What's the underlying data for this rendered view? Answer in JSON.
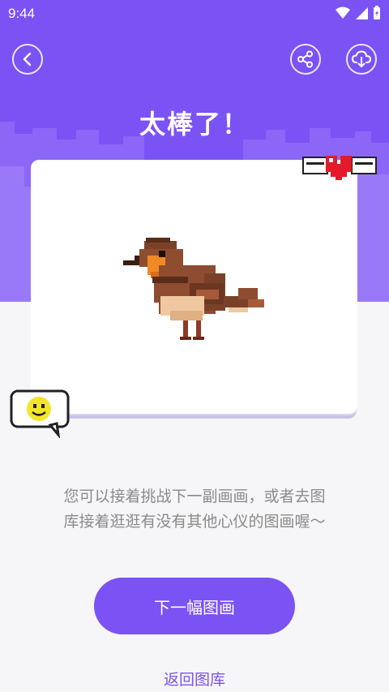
{
  "status_bar": {
    "time": "9:44"
  },
  "header": {
    "title": "太棒了！",
    "back_icon": "chevron-left-icon",
    "share_icon": "share-icon",
    "download_icon": "cloud-download-icon"
  },
  "artwork": {
    "subject": "bird"
  },
  "message": {
    "line1": "您可以接着挑战下一副画画，或者去图",
    "line2": "库接着逛逛有没有其他心仪的图画喔～"
  },
  "actions": {
    "next_label": "下一幅图画",
    "back_label": "返回图库"
  },
  "colors": {
    "accent": "#7b52f4",
    "background": "#f6f6f8"
  }
}
